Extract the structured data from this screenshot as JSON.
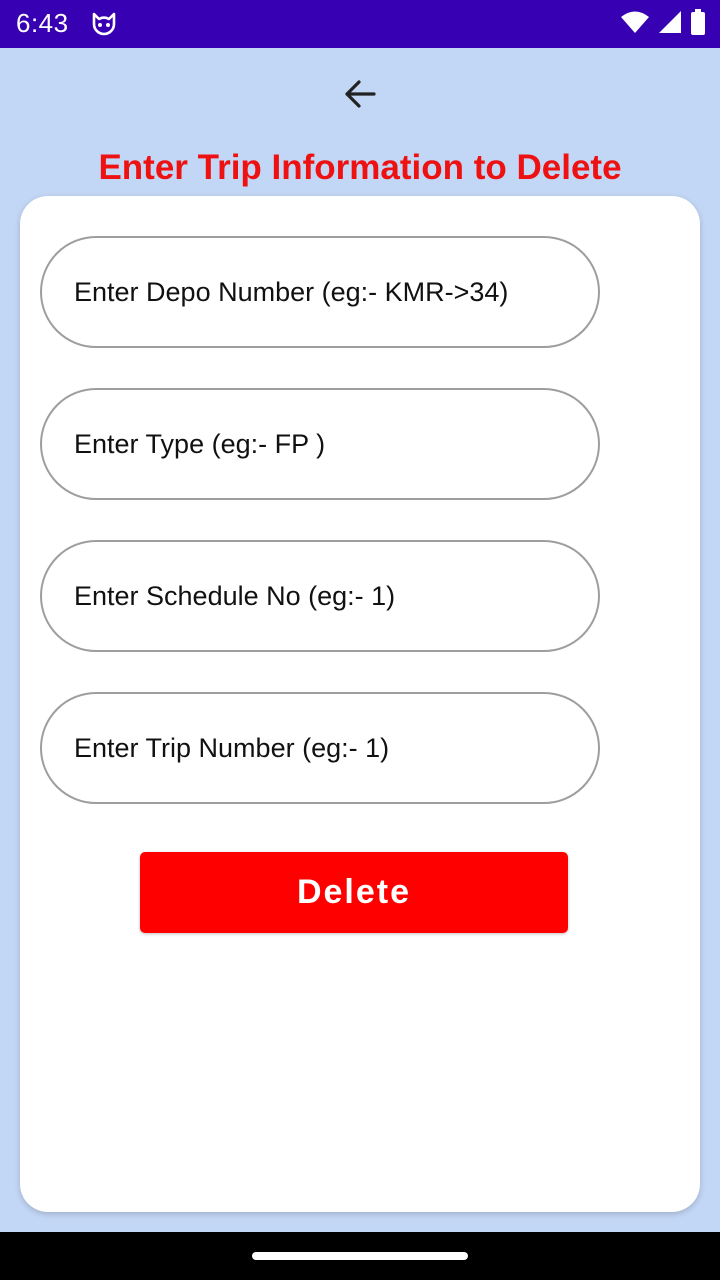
{
  "status_bar": {
    "time": "6:43",
    "icons": [
      "cat-app-icon",
      "wifi-icon",
      "signal-icon",
      "battery-icon"
    ]
  },
  "header": {
    "back_icon": "arrow-left-icon",
    "title": "Enter Trip Information to Delete",
    "title_color": "#ee1111"
  },
  "form": {
    "depo_number": {
      "placeholder": "Enter Depo Number (eg:- KMR->34)",
      "value": ""
    },
    "type": {
      "placeholder": "Enter Type (eg:- FP )",
      "value": ""
    },
    "schedule_no": {
      "placeholder": "Enter Schedule No (eg:- 1)",
      "value": ""
    },
    "trip_number": {
      "placeholder": "Enter Trip Number (eg:- 1)",
      "value": ""
    },
    "delete_label": "Delete",
    "delete_color": "#ff0000"
  },
  "colors": {
    "status_bar": "#3700b3",
    "background": "#c2d6f5",
    "card": "#ffffff"
  }
}
